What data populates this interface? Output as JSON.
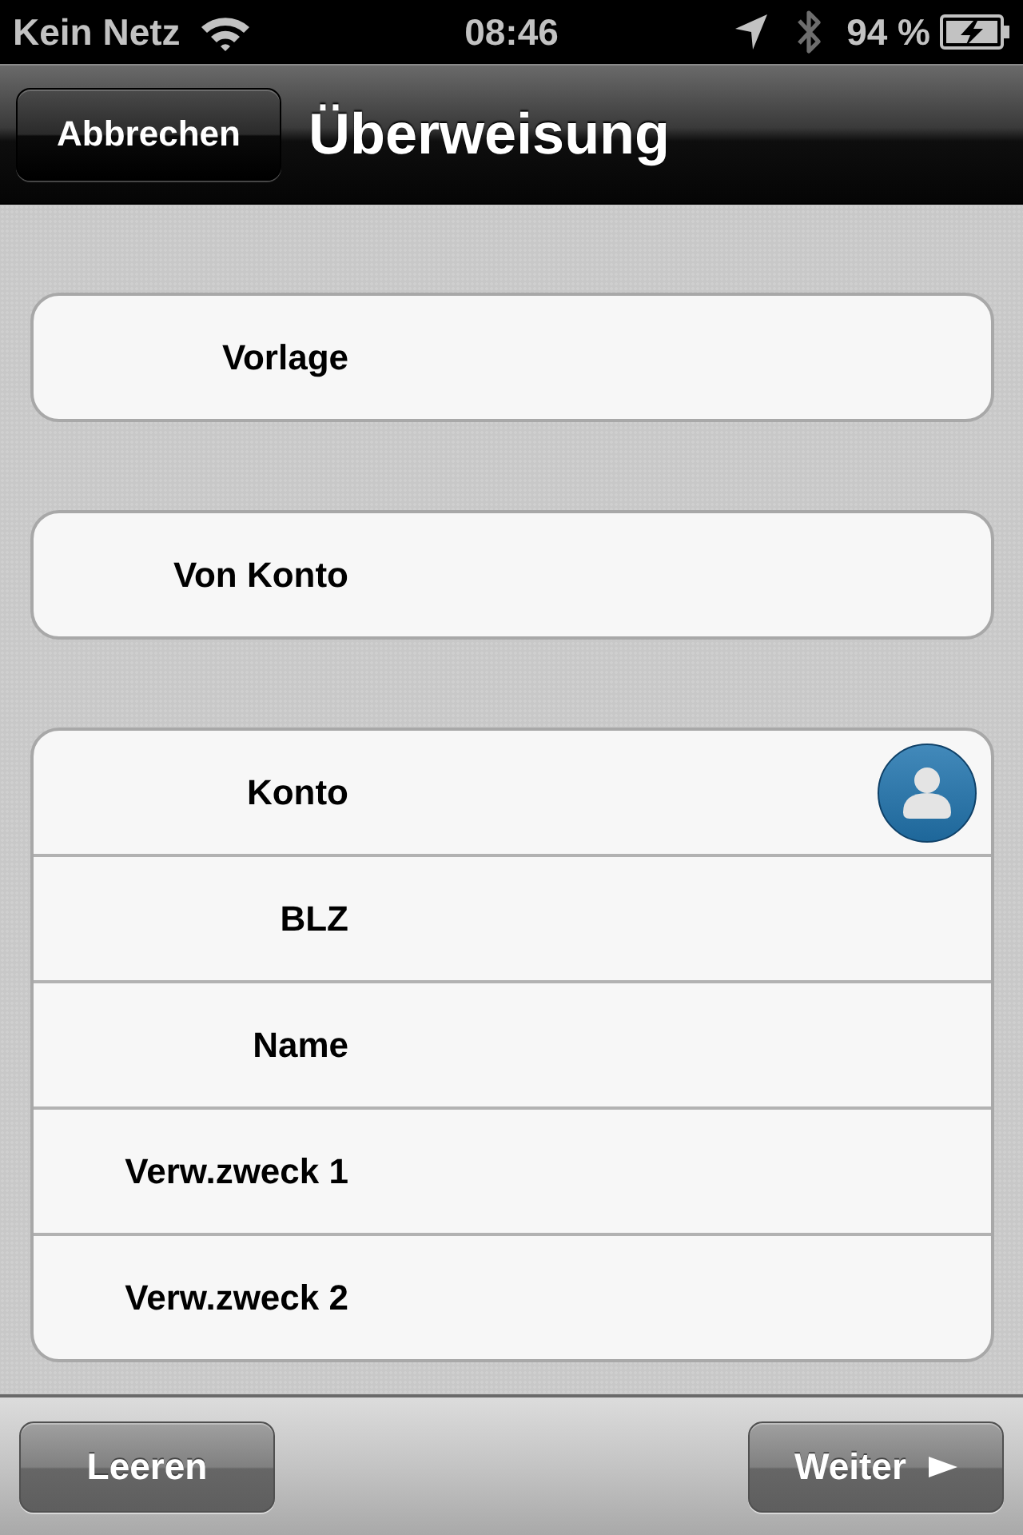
{
  "status_bar": {
    "carrier": "Kein Netz",
    "time": "08:46",
    "battery": "94 %"
  },
  "nav_bar": {
    "cancel_button": "Abbrechen",
    "title": "Überweisung"
  },
  "groups": [
    {
      "fields": [
        {
          "label": "Vorlage",
          "kind": "text"
        }
      ]
    },
    {
      "fields": [
        {
          "label": "Von Konto",
          "kind": "text"
        }
      ]
    },
    {
      "fields": [
        {
          "label": "Konto",
          "kind": "contact"
        },
        {
          "label": "BLZ",
          "kind": "text"
        },
        {
          "label": "Name",
          "kind": "text"
        },
        {
          "label": "Verw.zweck 1",
          "kind": "text"
        },
        {
          "label": "Verw.zweck 2",
          "kind": "text"
        }
      ]
    }
  ],
  "toolbar": {
    "buttons": [
      {
        "label": "Leeren",
        "kind": "plain"
      },
      {
        "label": "Weiter",
        "kind": "next"
      }
    ]
  }
}
